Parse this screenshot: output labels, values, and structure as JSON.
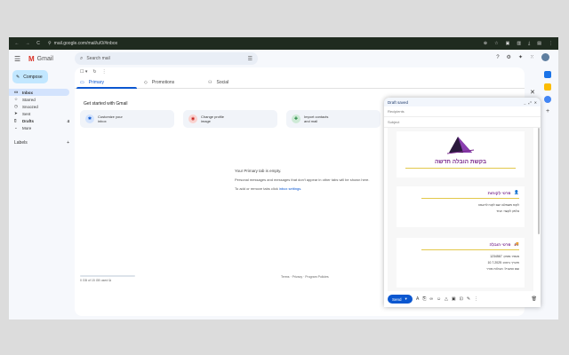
{
  "browser": {
    "url": "mail.google.com/mail/u/0/#inbox",
    "back": "←",
    "forward": "→",
    "reload": "C"
  },
  "app": {
    "name": "Gmail",
    "logo_letter": "M"
  },
  "search": {
    "placeholder": "Search mail"
  },
  "compose": {
    "label": "Compose"
  },
  "sidebar": {
    "items": [
      {
        "label": "Inbox",
        "icon": "▭",
        "active": true
      },
      {
        "label": "Starred",
        "icon": "☆"
      },
      {
        "label": "Snoozed",
        "icon": "◷"
      },
      {
        "label": "Sent",
        "icon": "➤"
      },
      {
        "label": "Drafts",
        "icon": "▯",
        "count": "4"
      },
      {
        "label": "More",
        "icon": "⌄"
      }
    ],
    "labels_title": "Labels",
    "labels_add": "+"
  },
  "tabs": [
    {
      "label": "Primary",
      "icon": "▭"
    },
    {
      "label": "Promotions",
      "icon": "◇"
    },
    {
      "label": "Social",
      "icon": "⚇"
    }
  ],
  "getstarted": {
    "title": "Get started with Gmail",
    "cards": [
      {
        "line1": "Customize your",
        "line2": "inbox",
        "icon": "✱",
        "bg": "#d3e3fd",
        "fg": "#0b57d0"
      },
      {
        "line1": "Change profile",
        "line2": "image",
        "icon": "◉",
        "bg": "#fad2cf",
        "fg": "#c5221f"
      },
      {
        "line1": "Import contacts",
        "line2": "and mail",
        "icon": "✚",
        "bg": "#ceead6",
        "fg": "#188038"
      }
    ]
  },
  "empty": {
    "title": "Your Primary tab is empty.",
    "line2": "Personal messages and messages that don't appear in other tabs will be shown here.",
    "line3": "To add or remove tabs click ",
    "link": "inbox settings."
  },
  "storage": {
    "text": "0 GB of 15 GB used"
  },
  "footer": {
    "text": "Terms · Privacy · Program Policies"
  },
  "draft": {
    "title": "Draft saved",
    "controls": [
      "_",
      "⤢",
      "✕"
    ],
    "recipients": "Recipients",
    "subject": "Subject",
    "letter_title": "בקשת הובלה חדשה",
    "sections": [
      {
        "title": "פרטי לקוחות",
        "icon": "👤",
        "rows": [
          "לקוח משתלם: שם לקוח לדוגמה",
          "טלפון לקשר: אחד"
        ]
      },
      {
        "title": "פרטי הובלה",
        "icon": "🚚",
        "rows": [
          "מספר מזמין: 1234567",
          "תאריך ביצוע: 10.7.2025",
          "שם המוביל: הובלות מהיר"
        ]
      }
    ],
    "send": "Send"
  }
}
